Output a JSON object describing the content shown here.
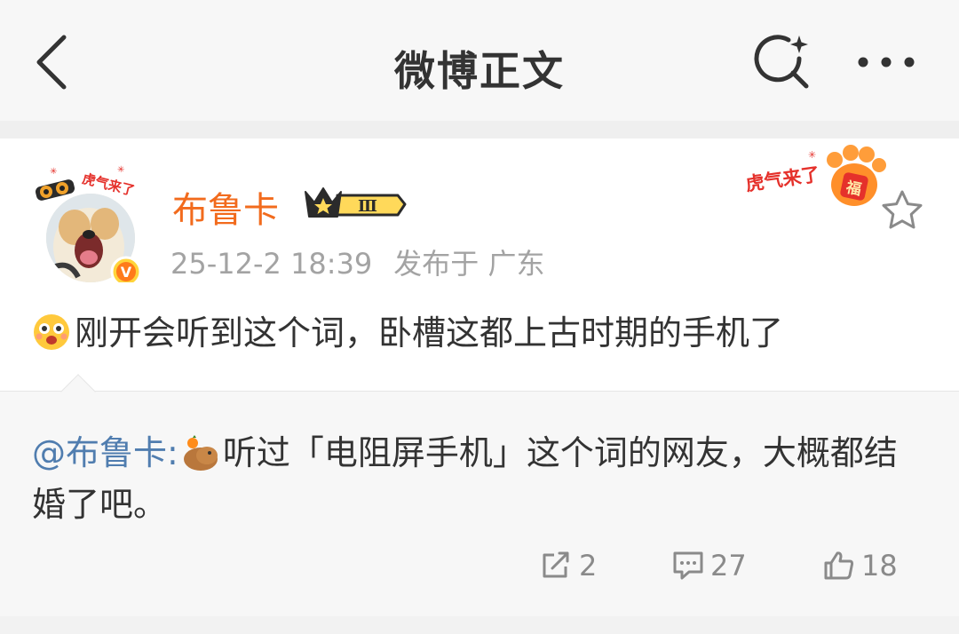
{
  "header": {
    "title": "微博正文",
    "icons": {
      "back": "back-arrow-icon",
      "search": "search-sparkle-icon",
      "more": "more-dots-icon"
    }
  },
  "post": {
    "username": "布鲁卡",
    "vip_level": "Ⅲ",
    "timestamp": "25-12-2 18:39",
    "source": "发布于 广东",
    "text": "刚开会听到这个词，卧槽这都上古时期的手机了",
    "avatar_badge": "V",
    "avatar_sticker_text": "虎气来了",
    "skin_text": "虎气来了",
    "skin_seal_text": "福"
  },
  "repost": {
    "mention": "@布鲁卡:",
    "text": "听过「电阻屏手机」这个词的网友，大概都结婚了吧。"
  },
  "actions": {
    "reposts": "2",
    "comments": "27",
    "likes": "18"
  },
  "colors": {
    "username": "#f26b1d",
    "mention": "#507daf",
    "meta": "#a3a3a3",
    "text": "#333333"
  }
}
